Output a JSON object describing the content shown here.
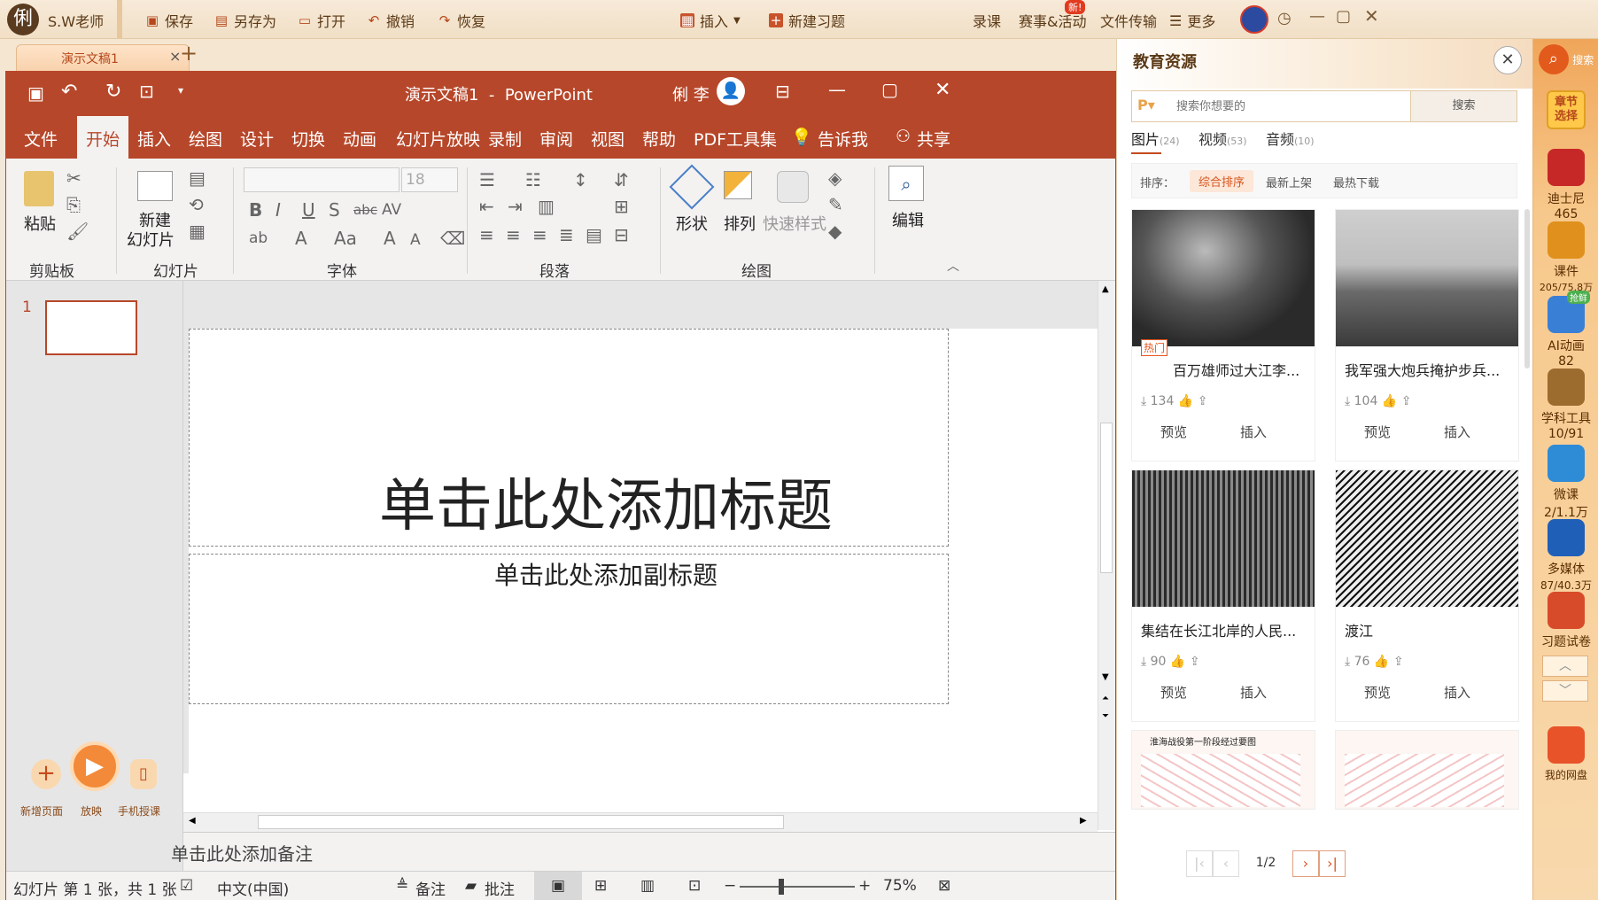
{
  "app": {
    "user_label": "S.W老师",
    "save": "保存",
    "save_as": "另存为",
    "open": "打开",
    "undo": "撤销",
    "redo": "恢复",
    "insert": "插入",
    "new_exercise": "新建习题",
    "record": "录课",
    "events": "赛事&活动",
    "events_badge": "新!",
    "file_transfer": "文件传输",
    "more": "更多"
  },
  "doc_tab": {
    "label": "演示文稿1",
    "close": "×",
    "add": "+"
  },
  "ppt": {
    "title": "演示文稿1  -  PowerPoint",
    "user": "俐 李",
    "menu": [
      "文件",
      "开始",
      "插入",
      "绘图",
      "设计",
      "切换",
      "动画",
      "幻灯片放映",
      "录制",
      "审阅",
      "视图",
      "帮助",
      "PDF工具集"
    ],
    "tell_me": "告诉我",
    "share": "共享",
    "ribbon": {
      "paste": "粘贴",
      "clipboard": "剪贴板",
      "new_slide_1": "新建",
      "new_slide_2": "幻灯片",
      "slides": "幻灯片",
      "font_size": "18",
      "font": "字体",
      "paragraph": "段落",
      "shape": "形状",
      "arrange": "排列",
      "quick_styles": "快速样式",
      "drawing": "绘图",
      "edit": "编辑"
    },
    "slide_number": "1",
    "title_placeholder": "单击此处添加标题",
    "subtitle_placeholder": "单击此处添加副标题",
    "notes_placeholder": "单击此处添加备注",
    "float": {
      "new_page": "新增页面",
      "play": "放映",
      "mobile": "手机授课"
    },
    "status": {
      "slide": "幻灯片 第 1 张，共 1 张",
      "lang": "中文(中国)",
      "notes": "备注",
      "comments": "批注",
      "zoom": "75%"
    }
  },
  "panel": {
    "title": "教育资源",
    "search_placeholder": "搜索你想要的",
    "search_btn": "搜索",
    "tabs": [
      {
        "label": "图片",
        "count": "(24)"
      },
      {
        "label": "视频",
        "count": "(53)"
      },
      {
        "label": "音频",
        "count": "(10)"
      }
    ],
    "sort_label": "排序：",
    "sorts": [
      "综合排序",
      "最新上架",
      "最热下载"
    ],
    "hot_tag": "热门",
    "cards": [
      {
        "title": "百万雄师过大江李...",
        "downloads": "134",
        "preview": "预览",
        "insert": "插入"
      },
      {
        "title": "我军强大炮兵掩护步兵...",
        "downloads": "104",
        "preview": "预览",
        "insert": "插入"
      },
      {
        "title": "集结在长江北岸的人民...",
        "downloads": "90",
        "preview": "预览",
        "insert": "插入"
      },
      {
        "title": "渡江",
        "downloads": "76",
        "preview": "预览",
        "insert": "插入"
      }
    ],
    "map_title": "淮海战役第一阶段经过要图",
    "page": "1/2"
  },
  "sidebar": {
    "search": "搜索",
    "chapter": "章节选择",
    "items": [
      {
        "label": "迪士尼",
        "count": "465"
      },
      {
        "label": "课件",
        "count": "205/75.8万"
      },
      {
        "label": "AI动画",
        "count": "82",
        "badge": "抢鲜"
      },
      {
        "label": "学科工具",
        "count": "10/91"
      },
      {
        "label": "微课",
        "count": "2/1.1万"
      },
      {
        "label": "多媒体",
        "count": "87/40.3万"
      },
      {
        "label": "习题试卷",
        "count": ""
      }
    ],
    "netdisk": "我的网盘"
  }
}
